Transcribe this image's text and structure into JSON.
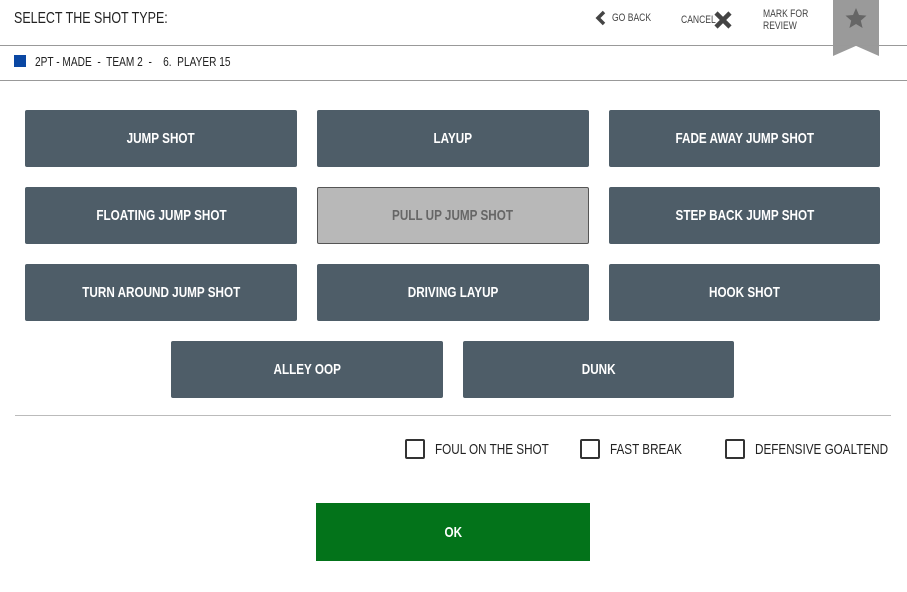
{
  "header": {
    "title": "SELECT THE SHOT TYPE:",
    "go_back": "GO BACK",
    "cancel": "CANCEL",
    "mark_for_review": [
      "MARK FOR",
      "REVIEW"
    ]
  },
  "shot_info": {
    "text": "2PT - MADE  -  TEAM 2  -    6.  PLAYER 15",
    "team_color": "#0a47a3"
  },
  "shot_types": [
    "JUMP SHOT",
    "LAYUP",
    "FADE AWAY JUMP SHOT",
    "FLOATING JUMP SHOT",
    "PULL UP JUMP SHOT",
    "STEP BACK JUMP SHOT",
    "TURN AROUND JUMP SHOT",
    "DRIVING LAYUP",
    "HOOK SHOT",
    "ALLEY OOP",
    "DUNK"
  ],
  "selected_shot_type": "PULL UP JUMP SHOT",
  "options": [
    {
      "label": "FOUL ON THE SHOT",
      "checked": false
    },
    {
      "label": "FAST BREAK",
      "checked": false
    },
    {
      "label": "DEFENSIVE GOALTEND",
      "checked": false
    }
  ],
  "ok_label": "OK",
  "colors": {
    "button": "#4e5d68",
    "selected": "#b8b8b8",
    "ok": "#03731a"
  }
}
